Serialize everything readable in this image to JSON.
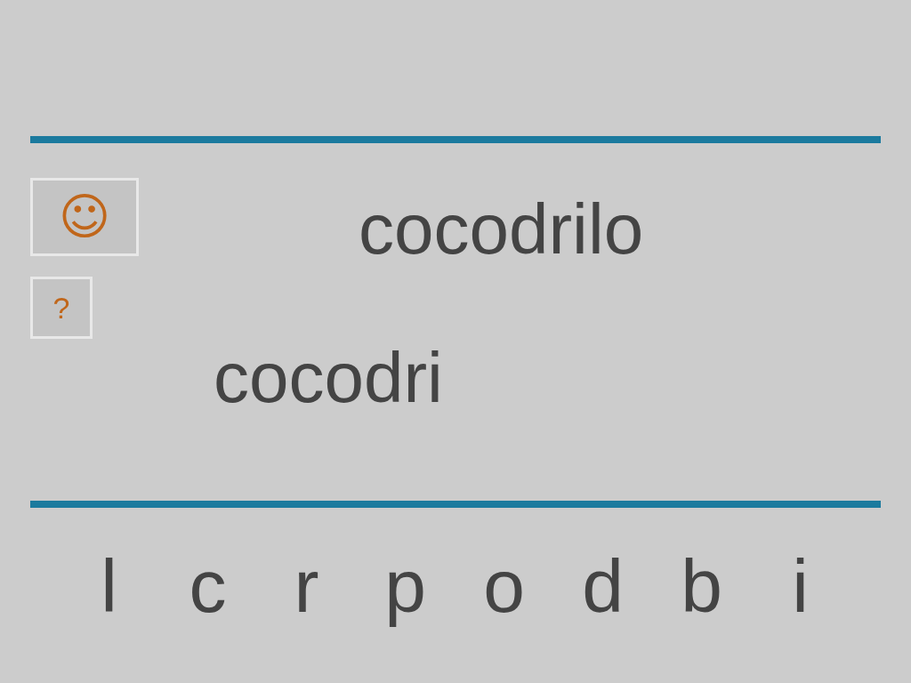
{
  "hint_button": {
    "label": "☺"
  },
  "target_word": "cocodrilo",
  "help_button": {
    "label": "?"
  },
  "answer": "cocodri",
  "letters": [
    "l",
    "c",
    "r",
    "p",
    "o",
    "d",
    "b",
    "i"
  ]
}
